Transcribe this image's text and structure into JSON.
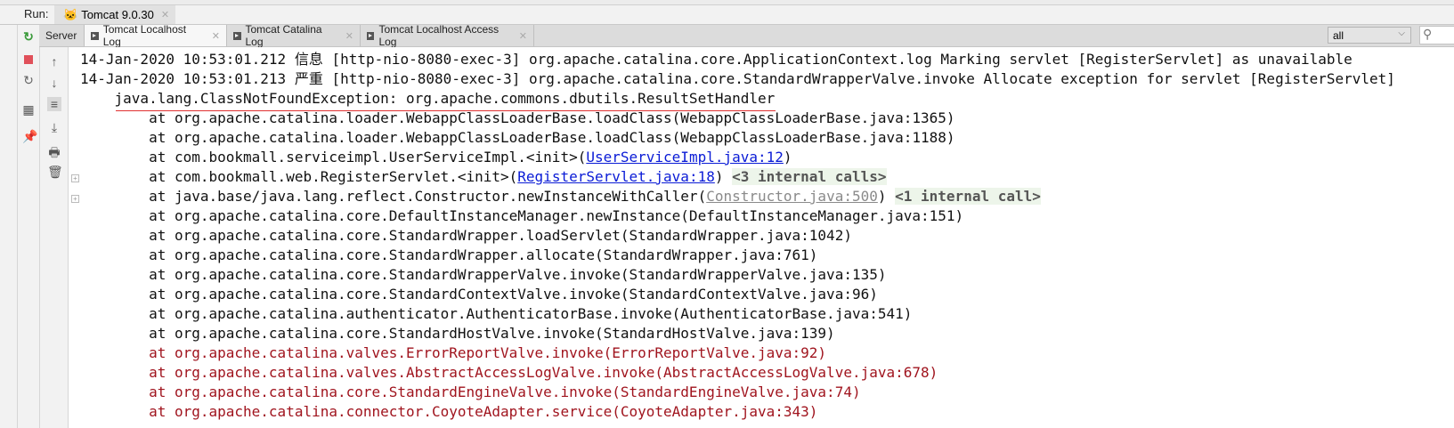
{
  "run": {
    "label": "Run:",
    "config_tab": "Tomcat 9.0.30"
  },
  "tabs": [
    {
      "label": "Server"
    },
    {
      "label": "Tomcat Localhost Log",
      "active": true
    },
    {
      "label": "Tomcat Catalina Log"
    },
    {
      "label": "Tomcat Localhost Access Log"
    }
  ],
  "filter": {
    "value": "all"
  },
  "log": {
    "l0": "14-Jan-2020 10:53:01.212 信息 [http-nio-8080-exec-3] org.apache.catalina.core.ApplicationContext.log Marking servlet [RegisterServlet] as unavailable",
    "l1": "14-Jan-2020 10:53:01.213 严重 [http-nio-8080-exec-3] org.apache.catalina.core.StandardWrapperValve.invoke Allocate exception for servlet [RegisterServlet]",
    "l2": "    java.lang.ClassNotFoundException: org.apache.commons.dbutils.ResultSetHandler",
    "l3": "        at org.apache.catalina.loader.WebappClassLoaderBase.loadClass(WebappClassLoaderBase.java:1365)",
    "l4": "        at org.apache.catalina.loader.WebappClassLoaderBase.loadClass(WebappClassLoaderBase.java:1188)",
    "l5a": "        at com.bookmall.serviceimpl.UserServiceImpl.<init>(",
    "l5link": "UserServiceImpl.java:12",
    "l5b": ")",
    "l6a": "        at com.bookmall.web.RegisterServlet.<init>(",
    "l6link": "RegisterServlet.java:18",
    "l6b": ") ",
    "l6calls": "<3 internal calls>",
    "l7a": "        at java.base/java.lang.reflect.Constructor.newInstanceWithCaller(",
    "l7link": "Constructor.java:500",
    "l7b": ") ",
    "l7calls": "<1 internal call>",
    "l8": "        at org.apache.catalina.core.DefaultInstanceManager.newInstance(DefaultInstanceManager.java:151)",
    "l9": "        at org.apache.catalina.core.StandardWrapper.loadServlet(StandardWrapper.java:1042)",
    "l10": "        at org.apache.catalina.core.StandardWrapper.allocate(StandardWrapper.java:761)",
    "l11": "        at org.apache.catalina.core.StandardWrapperValve.invoke(StandardWrapperValve.java:135)",
    "l12": "        at org.apache.catalina.core.StandardContextValve.invoke(StandardContextValve.java:96)",
    "l13": "        at org.apache.catalina.authenticator.AuthenticatorBase.invoke(AuthenticatorBase.java:541)",
    "l14": "        at org.apache.catalina.core.StandardHostValve.invoke(StandardHostValve.java:139)",
    "l15": "        at org.apache.catalina.valves.ErrorReportValve.invoke(ErrorReportValve.java:92)",
    "l16": "        at org.apache.catalina.valves.AbstractAccessLogValve.invoke(AbstractAccessLogValve.java:678)",
    "l17": "        at org.apache.catalina.core.StandardEngineValve.invoke(StandardEngineValve.java:74)",
    "l18": "        at org.apache.catalina.connector.CoyoteAdapter.service(CoyoteAdapter.java:343)"
  },
  "colors": {
    "error_red": "#a0141e",
    "link_blue": "#0a1bd6",
    "internal_bg": "#edf5ea"
  }
}
